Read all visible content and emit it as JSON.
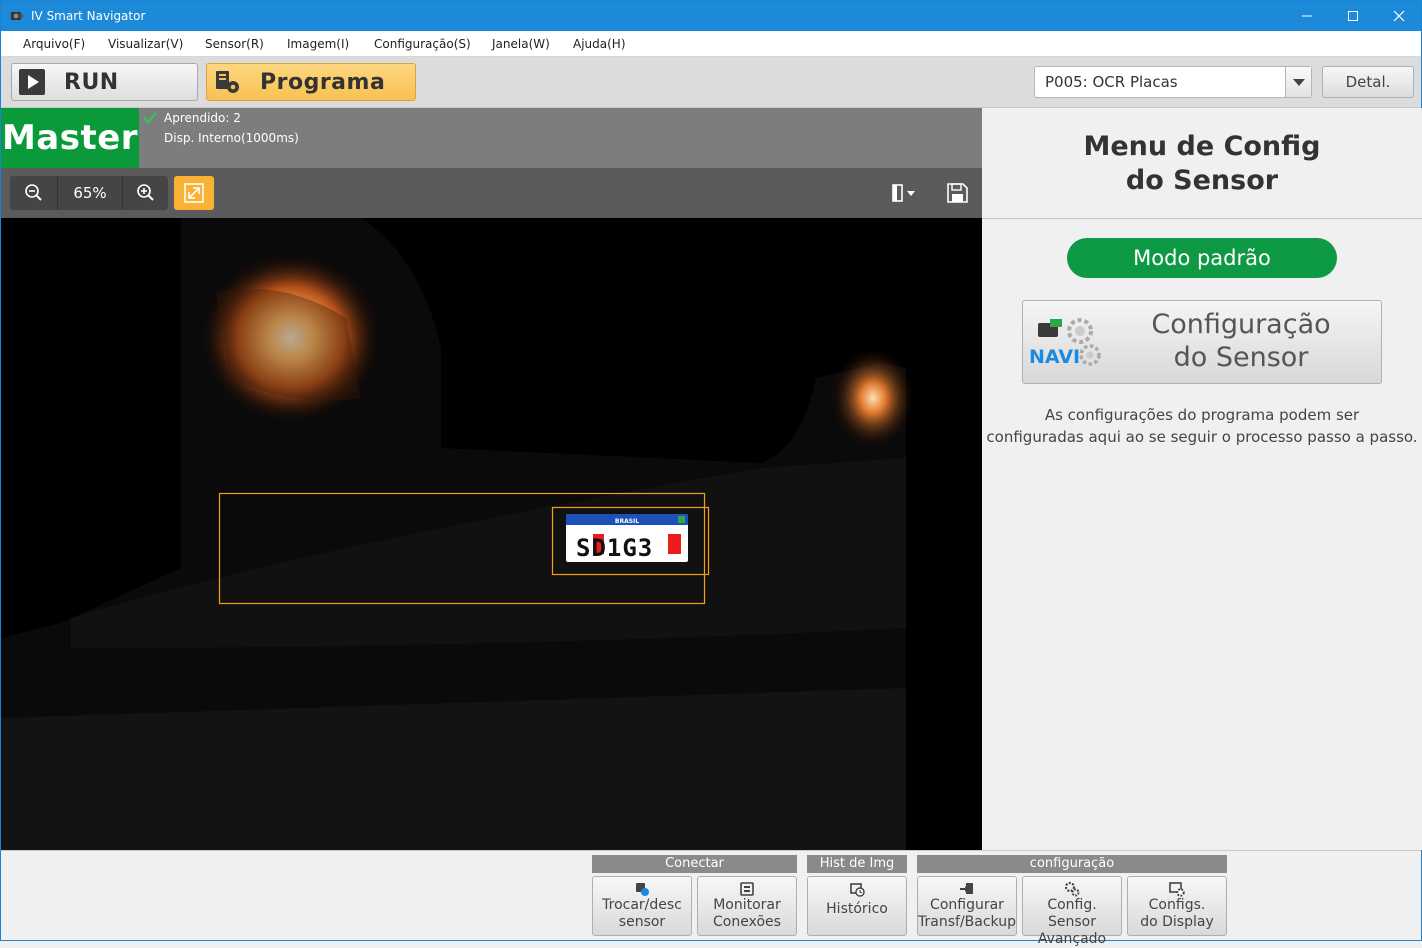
{
  "window": {
    "title": "IV Smart Navigator"
  },
  "menu": [
    "Arquivo(F)",
    "Visualizar(V)",
    "Sensor(R)",
    "Imagem(I)",
    "Configuração(S)",
    "Janela(W)",
    "Ajuda(H)"
  ],
  "toolbar": {
    "run_label": "RUN",
    "program_label": "Programa",
    "program_select": "P005: OCR Placas",
    "detail_label": "Detal."
  },
  "status": {
    "badge": "Master",
    "learned": "Aprendido: 2",
    "trigger": "Disp. Interno(1000ms)"
  },
  "zoom": {
    "level": "65%"
  },
  "plate": {
    "text": "SD1G3",
    "top_text": "BRASIL"
  },
  "right_panel": {
    "title_line1": "Menu de Config",
    "title_line2": "do Sensor",
    "mode_button": "Modo padrão",
    "config_line1": "Configuração",
    "config_line2": "do Sensor",
    "navi_logo": "NAVI",
    "desc_line1": "As configurações do programa podem ser",
    "desc_line2": "configuradas aqui ao se seguir o processo passo a passo."
  },
  "bottom": {
    "groups": [
      "Conectar",
      "Hist de Img",
      "configuração"
    ],
    "buttons": [
      {
        "l1": "Trocar/desc",
        "l2": "sensor"
      },
      {
        "l1": "Monitorar",
        "l2": "Conexões"
      },
      {
        "l1": "Histórico",
        "l2": ""
      },
      {
        "l1": "Configurar",
        "l2": "Transf/Backup"
      },
      {
        "l1": "Config. Sensor",
        "l2": "Avançado"
      },
      {
        "l1": "Configs.",
        "l2": "do Display"
      }
    ]
  },
  "colors": {
    "titlebar": "#1c8ad9",
    "program_active": "#f8c152",
    "master_green": "#0b9a3a",
    "roi_orange": "#f0a012"
  }
}
